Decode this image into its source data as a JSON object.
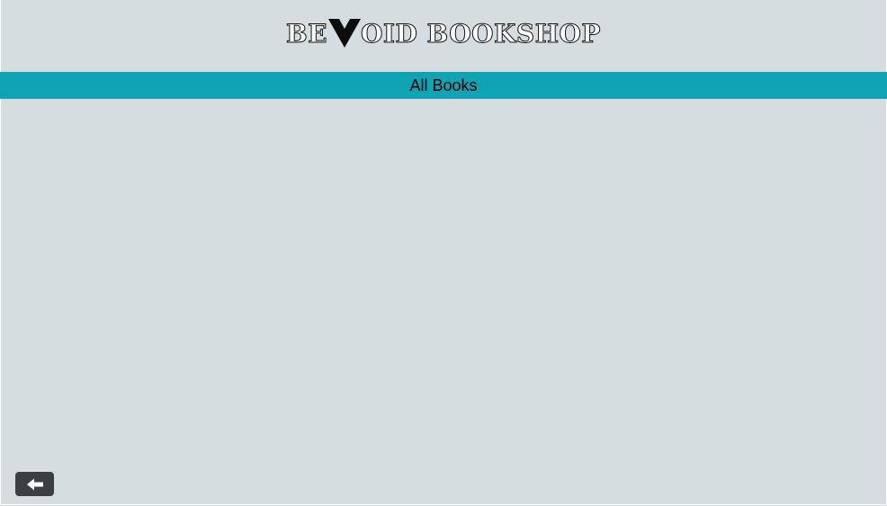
{
  "header": {
    "logo_part1": "BE",
    "logo_part2": "OID BOOKSHOP"
  },
  "navbar": {
    "title": "All Books"
  },
  "icons": {
    "logo": "v-triangle-logo-icon",
    "back": "arrow-left-icon"
  },
  "colors": {
    "background": "#d6dde0",
    "navbar": "#10a3b4",
    "back_button": "#3b3f43"
  }
}
